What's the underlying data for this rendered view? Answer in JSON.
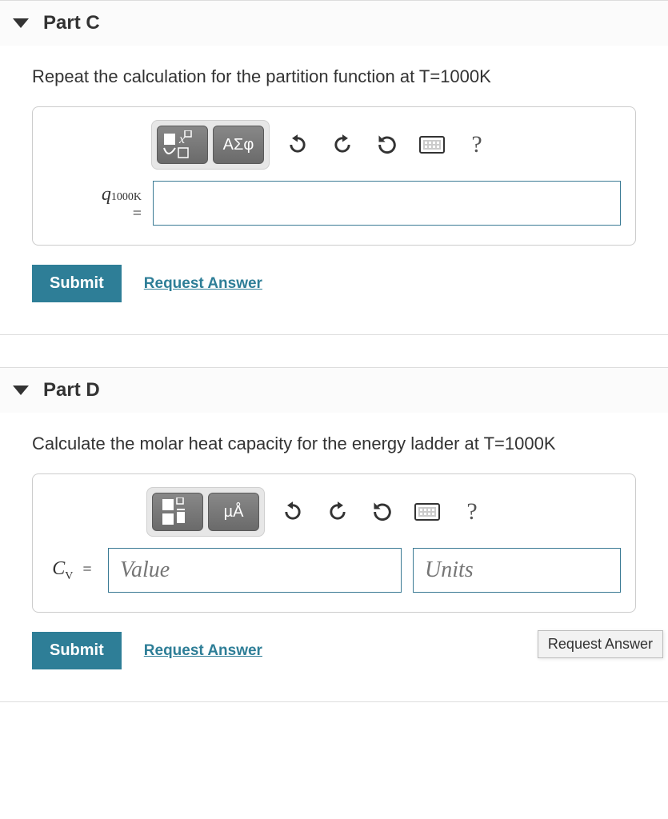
{
  "parts": {
    "c": {
      "title": "Part C",
      "question": "Repeat the calculation for the partition function at T=1000K",
      "lhs_variable": "q",
      "lhs_subscript": "1000K",
      "lhs_eq": "=",
      "answer_value": "",
      "submit_label": "Submit",
      "request_label": "Request Answer",
      "toolbar": {
        "greek_label": "ΑΣφ"
      }
    },
    "d": {
      "title": "Part D",
      "question": "Calculate the molar heat capacity for the energy ladder at T=1000K",
      "lhs_variable": "C",
      "lhs_subscript": "V",
      "lhs_eq": "=",
      "value_placeholder": "Value",
      "units_placeholder": "Units",
      "submit_label": "Submit",
      "request_label": "Request Answer",
      "toolbar": {
        "units_label": "µÅ"
      },
      "tooltip": "Request Answer"
    }
  },
  "common": {
    "help_symbol": "?"
  }
}
